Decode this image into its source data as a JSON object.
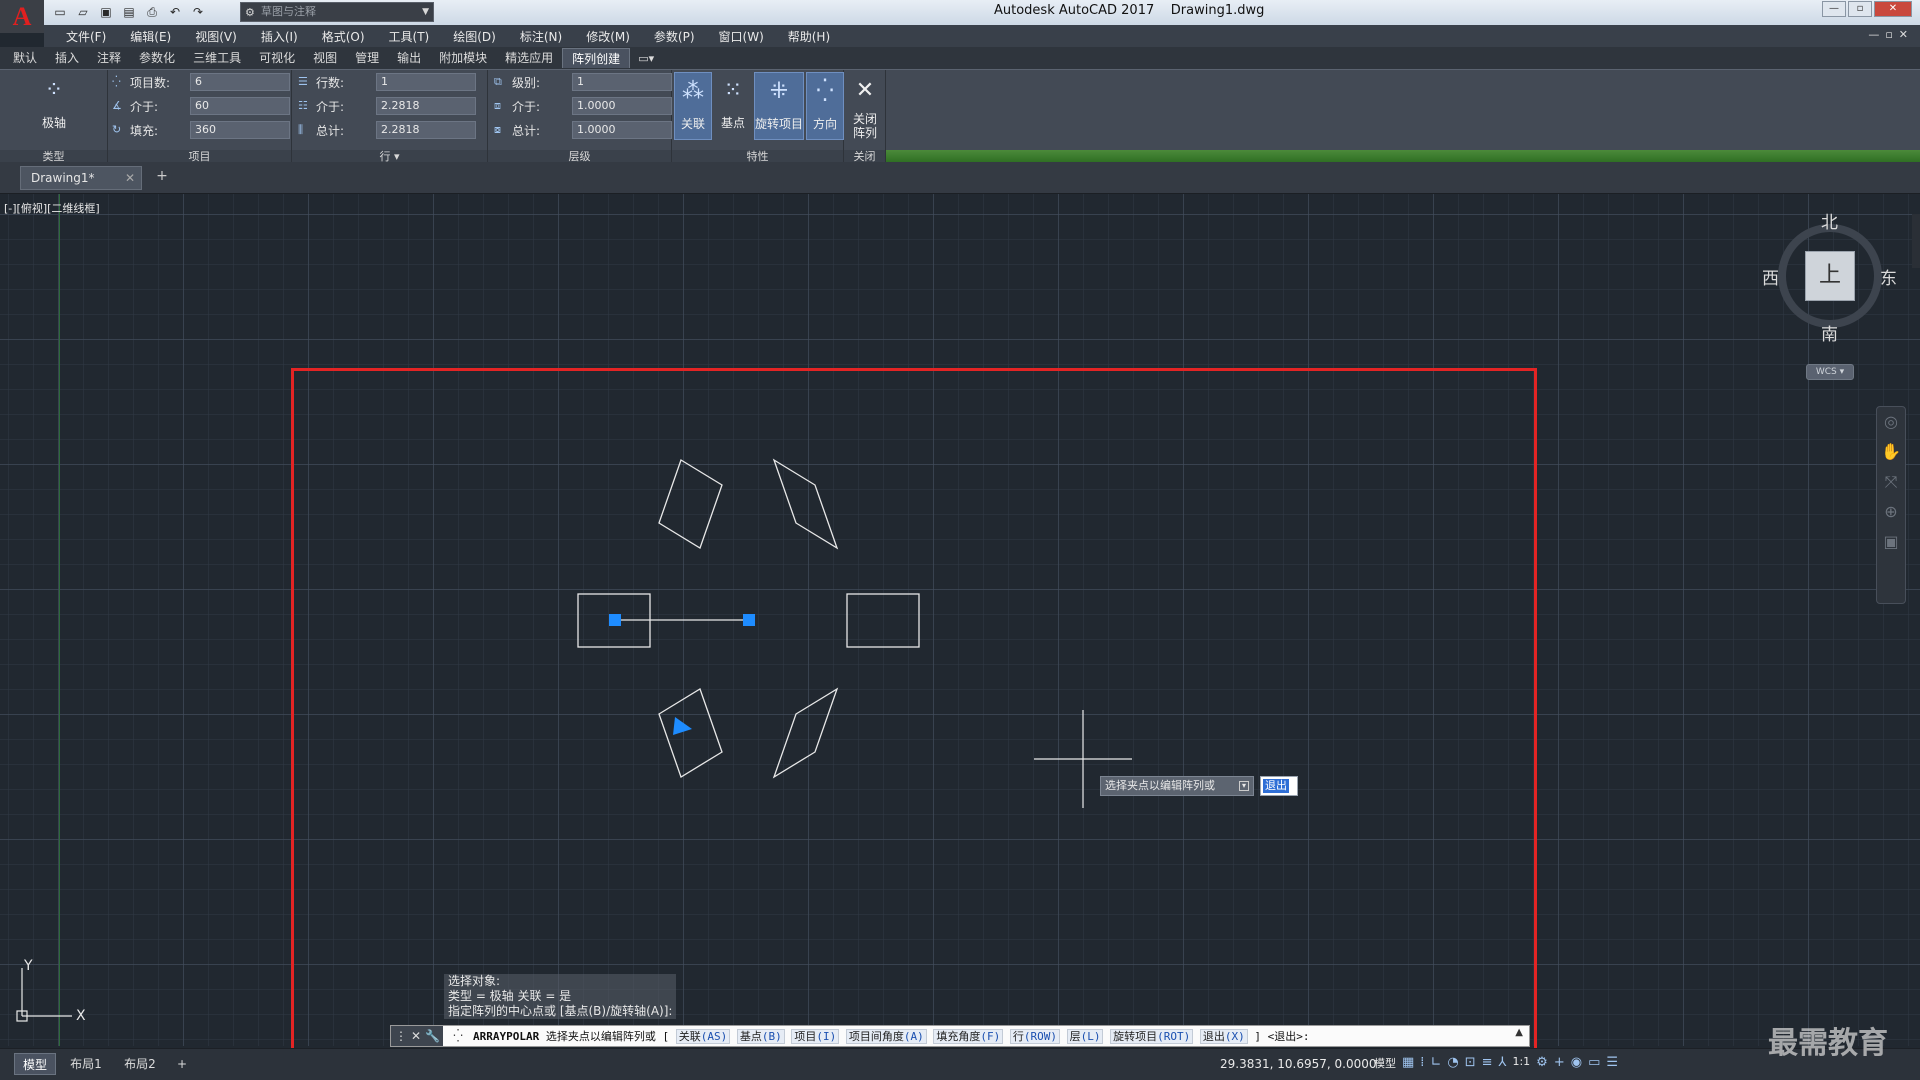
{
  "titlebar": {
    "app_letter": "A",
    "workspace": "草图与注释",
    "title": "Autodesk AutoCAD 2017    Drawing1.dwg"
  },
  "menu": [
    "文件(F)",
    "编辑(E)",
    "视图(V)",
    "插入(I)",
    "格式(O)",
    "工具(T)",
    "绘图(D)",
    "标注(N)",
    "修改(M)",
    "参数(P)",
    "窗口(W)",
    "帮助(H)"
  ],
  "ribbon_tabs": [
    "默认",
    "插入",
    "注释",
    "参数化",
    "三维工具",
    "可视化",
    "视图",
    "管理",
    "输出",
    "附加模块",
    "精选应用",
    "阵列创建"
  ],
  "ribbon_tabs_active": "阵列创建",
  "ribbon": {
    "type": {
      "button": "极轴",
      "label": "类型"
    },
    "items": {
      "label": "项目",
      "rows": [
        {
          "label": "项目数:",
          "value": "6"
        },
        {
          "label": "介于:",
          "value": "60"
        },
        {
          "label": "填充:",
          "value": "360"
        }
      ]
    },
    "rows": {
      "label": "行 ▾",
      "rows": [
        {
          "label": "行数:",
          "value": "1"
        },
        {
          "label": "介于:",
          "value": "2.2818"
        },
        {
          "label": "总计:",
          "value": "2.2818"
        }
      ]
    },
    "levels": {
      "label": "层级",
      "rows": [
        {
          "label": "级别:",
          "value": "1"
        },
        {
          "label": "介于:",
          "value": "1.0000"
        },
        {
          "label": "总计:",
          "value": "1.0000"
        }
      ]
    },
    "properties": {
      "label": "特性",
      "buttons": [
        "关联",
        "基点",
        "旋转项目",
        "方向"
      ]
    },
    "close": {
      "label": "关闭",
      "button_line1": "关闭",
      "button_line2": "阵列"
    }
  },
  "file_tab": "Drawing1*",
  "viewport_label": "[-][俯视][二维线框]",
  "viewcube": {
    "north": "北",
    "south": "南",
    "west": "西",
    "east": "东",
    "face": "上",
    "wcs": "WCS"
  },
  "ucs": {
    "x": "X",
    "y": "Y"
  },
  "command_history": [
    "选择对象:",
    "类型 = 极轴  关联 = 是",
    "指定阵列的中心点或 [基点(B)/旋转轴(A)]:"
  ],
  "dynamic_prompt": "选择夹点以编辑阵列或",
  "dynamic_input": "退出",
  "command_line": {
    "command": "ARRAYPOLAR",
    "prompt": "选择夹点以编辑阵列或 [",
    "options": [
      {
        "text": "关联",
        "key": "(AS)"
      },
      {
        "text": "基点",
        "key": "(B)"
      },
      {
        "text": "项目",
        "key": "(I)"
      },
      {
        "text": "项目间角度",
        "key": "(A)"
      },
      {
        "text": "填充角度",
        "key": "(F)"
      },
      {
        "text": "行",
        "key": "(ROW)"
      },
      {
        "text": "层",
        "key": "(L)"
      },
      {
        "text": "旋转项目",
        "key": "(ROT)"
      },
      {
        "text": "退出",
        "key": "(X)"
      }
    ],
    "suffix": "] <退出>:"
  },
  "status": {
    "layout_tabs": [
      "模型",
      "布局1",
      "布局2"
    ],
    "coords": "29.3831, 10.6957, 0.0000",
    "model_label": "模型",
    "scale": "1:1"
  },
  "watermark": "最需教育",
  "colors": {
    "frame": "#e32424",
    "grip": "#1e8cff",
    "background": "#212830"
  }
}
